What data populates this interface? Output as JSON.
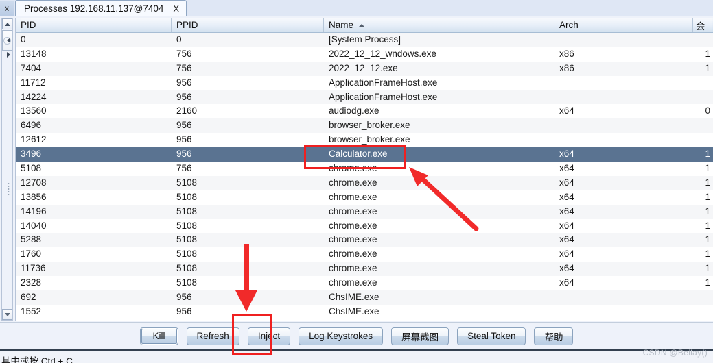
{
  "window": {
    "tab_stub_label": "x",
    "tab_title": "Processes 192.168.11.137@7404",
    "tab_close": "X"
  },
  "table": {
    "columns": [
      {
        "key": "pid",
        "label": "PID",
        "sorted": false
      },
      {
        "key": "ppid",
        "label": "PPID",
        "sorted": false
      },
      {
        "key": "name",
        "label": "Name",
        "sorted": true,
        "sort_dir": "asc"
      },
      {
        "key": "arch",
        "label": "Arch",
        "sorted": false
      },
      {
        "key": "extra",
        "label": "会",
        "sorted": false
      }
    ],
    "rows": [
      {
        "pid": "0",
        "ppid": "0",
        "name": "[System Process]",
        "arch": "",
        "extra": "",
        "selected": false
      },
      {
        "pid": "13148",
        "ppid": "756",
        "name": "2022_12_12_wndows.exe",
        "arch": "x86",
        "extra": "1",
        "selected": false
      },
      {
        "pid": "7404",
        "ppid": "756",
        "name": "2022_12_12.exe",
        "arch": "x86",
        "extra": "1",
        "selected": false
      },
      {
        "pid": "11712",
        "ppid": "956",
        "name": "ApplicationFrameHost.exe",
        "arch": "",
        "extra": "",
        "selected": false
      },
      {
        "pid": "14224",
        "ppid": "956",
        "name": "ApplicationFrameHost.exe",
        "arch": "",
        "extra": "",
        "selected": false
      },
      {
        "pid": "13560",
        "ppid": "2160",
        "name": "audiodg.exe",
        "arch": "x64",
        "extra": "0",
        "selected": false
      },
      {
        "pid": "6496",
        "ppid": "956",
        "name": "browser_broker.exe",
        "arch": "",
        "extra": "",
        "selected": false
      },
      {
        "pid": "12612",
        "ppid": "956",
        "name": "browser_broker.exe",
        "arch": "",
        "extra": "",
        "selected": false
      },
      {
        "pid": "3496",
        "ppid": "956",
        "name": "Calculator.exe",
        "arch": "x64",
        "extra": "1",
        "selected": true
      },
      {
        "pid": "5108",
        "ppid": "756",
        "name": "chrome.exe",
        "arch": "x64",
        "extra": "1",
        "selected": false
      },
      {
        "pid": "12708",
        "ppid": "5108",
        "name": "chrome.exe",
        "arch": "x64",
        "extra": "1",
        "selected": false
      },
      {
        "pid": "13856",
        "ppid": "5108",
        "name": "chrome.exe",
        "arch": "x64",
        "extra": "1",
        "selected": false
      },
      {
        "pid": "14196",
        "ppid": "5108",
        "name": "chrome.exe",
        "arch": "x64",
        "extra": "1",
        "selected": false
      },
      {
        "pid": "14040",
        "ppid": "5108",
        "name": "chrome.exe",
        "arch": "x64",
        "extra": "1",
        "selected": false
      },
      {
        "pid": "5288",
        "ppid": "5108",
        "name": "chrome.exe",
        "arch": "x64",
        "extra": "1",
        "selected": false
      },
      {
        "pid": "1760",
        "ppid": "5108",
        "name": "chrome.exe",
        "arch": "x64",
        "extra": "1",
        "selected": false
      },
      {
        "pid": "11736",
        "ppid": "5108",
        "name": "chrome.exe",
        "arch": "x64",
        "extra": "1",
        "selected": false
      },
      {
        "pid": "2328",
        "ppid": "5108",
        "name": "chrome.exe",
        "arch": "x64",
        "extra": "1",
        "selected": false
      },
      {
        "pid": "692",
        "ppid": "956",
        "name": "ChsIME.exe",
        "arch": "",
        "extra": "",
        "selected": false
      },
      {
        "pid": "1552",
        "ppid": "956",
        "name": "ChsIME.exe",
        "arch": "",
        "extra": "",
        "selected": false
      }
    ]
  },
  "buttons": [
    {
      "id": "kill",
      "label": "Kill",
      "focused": true
    },
    {
      "id": "refresh",
      "label": "Refresh",
      "focused": false
    },
    {
      "id": "inject",
      "label": "Inject",
      "focused": false
    },
    {
      "id": "log-keystrokes",
      "label": "Log Keystrokes",
      "focused": false
    },
    {
      "id": "screenshot",
      "label": "屏幕截图",
      "focused": false
    },
    {
      "id": "steal-token",
      "label": "Steal Token",
      "focused": false
    },
    {
      "id": "help",
      "label": "帮助",
      "focused": false
    }
  ],
  "status": {
    "text": "其中或按 Ctrl + C"
  },
  "watermark": {
    "text": "CSDN @Beilay()"
  },
  "colors": {
    "selection": "#5a7391",
    "annotation": "#ef2020",
    "header_border": "#a7bdd4",
    "row_odd": "#f5f6f8",
    "row_even": "#ffffff"
  }
}
